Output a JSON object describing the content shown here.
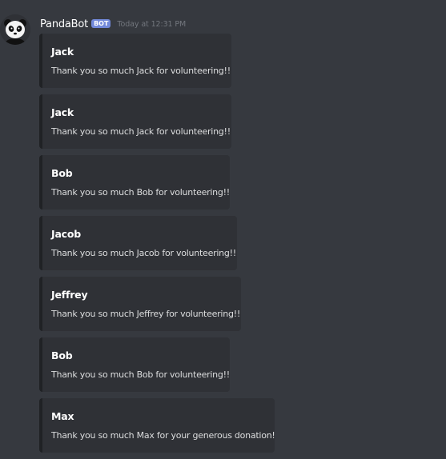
{
  "message": {
    "avatar_icon": "panda-avatar-icon",
    "username": "PandaBot",
    "bot_tag": "BOT",
    "timestamp": "Today at 12:31 PM",
    "embeds": [
      {
        "title": "Jack",
        "description": "Thank you so much Jack for volunteering!!"
      },
      {
        "title": "Jack",
        "description": "Thank you so much Jack for volunteering!!"
      },
      {
        "title": "Bob",
        "description": "Thank you so much Bob for volunteering!!"
      },
      {
        "title": "Jacob",
        "description": "Thank you so much Jacob for volunteering!!"
      },
      {
        "title": "Jeffrey",
        "description": "Thank you so much Jeffrey for volunteering!!"
      },
      {
        "title": "Bob",
        "description": "Thank you so much Bob for volunteering!!"
      },
      {
        "title": "Max",
        "description": "Thank you so much Max for your generous donation!"
      }
    ]
  },
  "colors": {
    "background": "#36393f",
    "embed_background": "#2f3136",
    "embed_border": "#202225",
    "bot_tag": "#7289da",
    "timestamp": "#72767d",
    "text": "#dcddde"
  }
}
